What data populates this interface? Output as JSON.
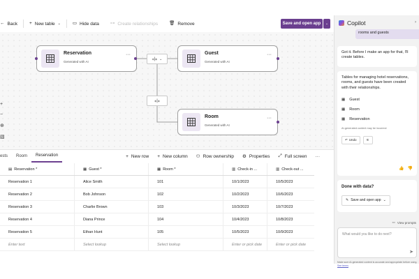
{
  "toolbar": {
    "back_label": "Back",
    "new_table_label": "New table",
    "hide_data_label": "Hide data",
    "create_relationships_label": "Create relationships",
    "remove_label": "Remove",
    "save_open_label": "Save and open app"
  },
  "canvas": {
    "nodes": [
      {
        "title": "Reservation",
        "subtitle": "Generated with AI"
      },
      {
        "title": "Guest",
        "subtitle": "Generated with AI"
      },
      {
        "title": "Room",
        "subtitle": "Generated with AI"
      }
    ],
    "relation_glyph": "⁎|⁎"
  },
  "table_tabs": {
    "tabs": [
      "ests",
      "Room",
      "Reservation"
    ],
    "active": "Reservation",
    "actions": {
      "new_row": "New row",
      "new_column": "New column",
      "row_ownership": "Row ownership",
      "properties": "Properties",
      "full_screen": "Full screen"
    }
  },
  "grid": {
    "columns": [
      "Reservation *",
      "Guest *",
      "Room *",
      "Check-in ...",
      "Check-out ..."
    ],
    "rows": [
      [
        "Reservation 1",
        "Alice Smith",
        "101",
        "10/1/2023",
        "10/5/2023"
      ],
      [
        "Reservation 2",
        "Bob Johnson",
        "102",
        "10/2/2023",
        "10/6/2023"
      ],
      [
        "Reservation 3",
        "Charlie Brown",
        "103",
        "10/3/2023",
        "10/7/2023"
      ],
      [
        "Reservation 4",
        "Diana Prince",
        "104",
        "10/4/2023",
        "10/8/2023"
      ],
      [
        "Reservation 5",
        "Ethan Hunt",
        "105",
        "10/5/2023",
        "10/9/2023"
      ]
    ],
    "input_row": [
      "Enter text",
      "Select lookup",
      "Select lookup",
      "Enter or pick date",
      "Enter or pick date"
    ]
  },
  "copilot": {
    "title": "Copilot",
    "user_message": "rooms and guests",
    "reply1": "Got it. Before I make an app for that, I'll create tables.",
    "reply2": "Tables for managing hotel reservations, rooms, and guests have been created with their relationships.",
    "tables": [
      "Guest",
      "Room",
      "Reservation"
    ],
    "ai_note": "AI-generated content may be incorrect",
    "undo_label": "Undo",
    "done_title": "Done with data?",
    "save_open_label": "Save and open app",
    "view_prompts_label": "View prompts",
    "input_placeholder": "What would you like to do next?",
    "disclaimer": "Make sure AI-generated content is accurate and appropriate before using.",
    "see_terms": "See terms"
  }
}
